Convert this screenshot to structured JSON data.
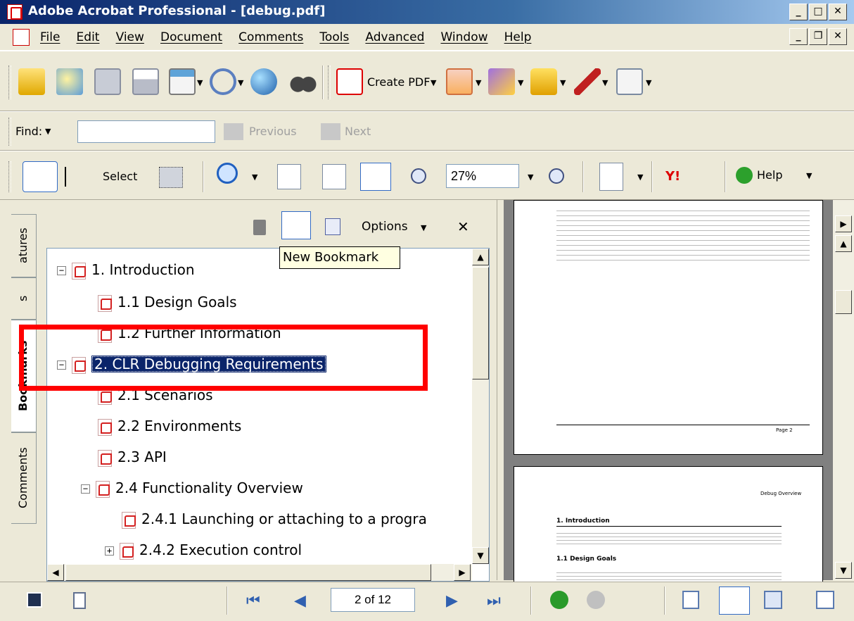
{
  "window": {
    "title": "Adobe Acrobat Professional - [debug.pdf]"
  },
  "menu": [
    "File",
    "Edit",
    "View",
    "Document",
    "Comments",
    "Tools",
    "Advanced",
    "Window",
    "Help"
  ],
  "toolbar": {
    "create_pdf": "Create PDF"
  },
  "find": {
    "label": "Find:",
    "value": "",
    "previous": "Previous",
    "next": "Next"
  },
  "view_tools": {
    "select": "Select",
    "zoom": "27%",
    "help": "Help"
  },
  "panel": {
    "options": "Options",
    "tabs": [
      "Signatures",
      "Layers",
      "Bookmarks",
      "Comments"
    ],
    "tab_visible": [
      "atures",
      "s",
      "Bookmarks",
      "Comments"
    ],
    "tooltip": "New Bookmark"
  },
  "bookmarks": [
    {
      "label": "1. Introduction",
      "expander": "⊟"
    },
    {
      "label": "1.1 Design Goals"
    },
    {
      "label": "1.2 Further Information"
    },
    {
      "label": "2. CLR Debugging Requirements",
      "expander": "⊟",
      "selected": true
    },
    {
      "label": "2.1 Scenarios"
    },
    {
      "label": "2.2 Environments"
    },
    {
      "label": "2.3 API"
    },
    {
      "label": "2.4 Functionality Overview",
      "expander": "⊟"
    },
    {
      "label": "2.4.1 Launching or attaching to a progra"
    },
    {
      "label": "2.4.2 Execution control",
      "expander": "⊞"
    }
  ],
  "doc": {
    "page1_footer": "Page 2",
    "page2_header": "Debug Overview",
    "page2_heading": "1. Introduction",
    "page2_subheading": "1.1 Design Goals"
  },
  "status": {
    "page": "2 of 12"
  },
  "colors": {
    "highlight": "#0a246a",
    "annotation": "#ff0000",
    "tooltip": "#ffffe1"
  }
}
